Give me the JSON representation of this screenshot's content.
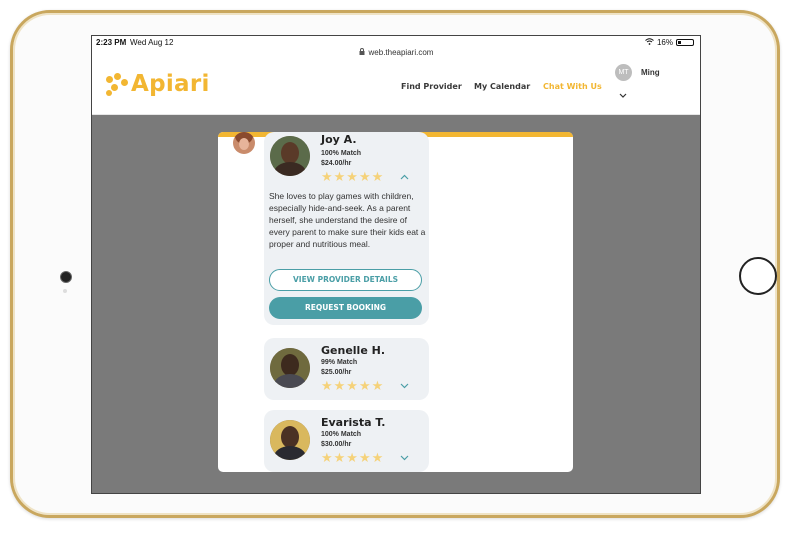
{
  "status_bar": {
    "time": "2:23 PM",
    "date": "Wed Aug 12",
    "battery": "16%",
    "battery_level": 0.16
  },
  "browser": {
    "url": "web.theapiari.com"
  },
  "header": {
    "logo_text": "Apiari",
    "nav": [
      {
        "label": "Find Provider",
        "active": false
      },
      {
        "label": "My Calendar",
        "active": false
      },
      {
        "label": "Chat With Us",
        "active": true
      }
    ],
    "user": {
      "initials": "MT",
      "name": "Ming"
    }
  },
  "colors": {
    "brand": "#f2b632",
    "accent": "#4a9ea6",
    "overlay": "#7a7a7a",
    "star": "#f5d27a"
  },
  "providers": [
    {
      "name": "Joy A.",
      "match": "100% Match",
      "rate": "$24.00/hr",
      "stars": "★★★★★",
      "expanded": true,
      "bio": "She loves to play games with children, especially hide-and-seek. As a parent herself, she understand the desire of every parent to make sure their kids eat a proper and nutritious meal.",
      "view_details_label": "VIEW PROVIDER DETAILS",
      "request_booking_label": "REQUEST BOOKING"
    },
    {
      "name": "Genelle H.",
      "match": "99% Match",
      "rate": "$25.00/hr",
      "stars": "★★★★★",
      "expanded": false
    },
    {
      "name": "Evarista T.",
      "match": "100% Match",
      "rate": "$30.00/hr",
      "stars": "★★★★★",
      "expanded": false
    }
  ],
  "icons": {
    "chevron_up": "⌃",
    "chevron_down": "⌄",
    "lock": "🔒",
    "wifi": "≋"
  }
}
